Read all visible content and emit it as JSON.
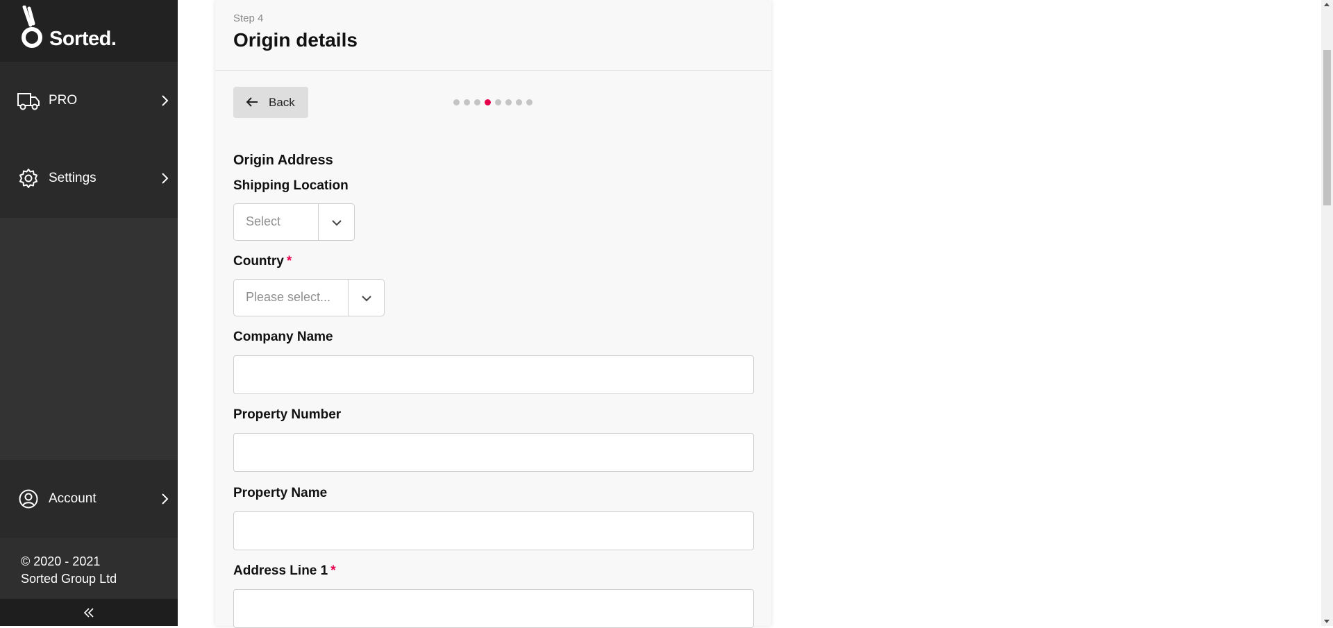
{
  "brand": {
    "logo_text": "Sorted.",
    "accent_color": "#e6004c"
  },
  "sidebar": {
    "items": [
      {
        "label": "PRO",
        "icon": "truck-icon"
      },
      {
        "label": "Settings",
        "icon": "gear-icon"
      },
      {
        "label": "Account",
        "icon": "user-circle-icon"
      }
    ],
    "copyright_line1": "© 2020 - 2021",
    "copyright_line2": "Sorted Group Ltd",
    "collapse_icon": "double-chevron-left-icon"
  },
  "header": {
    "step": "Step 4",
    "title": "Origin details"
  },
  "toolbar": {
    "back_label": "Back",
    "steps_total": 8,
    "current_step_index": 3
  },
  "form": {
    "section_title": "Origin Address",
    "shipping_location": {
      "label": "Shipping Location",
      "placeholder": "Select"
    },
    "country": {
      "label": "Country",
      "required_mark": "*",
      "placeholder": "Please select..."
    },
    "company_name": {
      "label": "Company Name",
      "value": ""
    },
    "property_number": {
      "label": "Property Number",
      "value": ""
    },
    "property_name": {
      "label": "Property Name",
      "value": ""
    },
    "address_line_1": {
      "label": "Address Line 1",
      "required_mark": "*",
      "value": ""
    }
  }
}
